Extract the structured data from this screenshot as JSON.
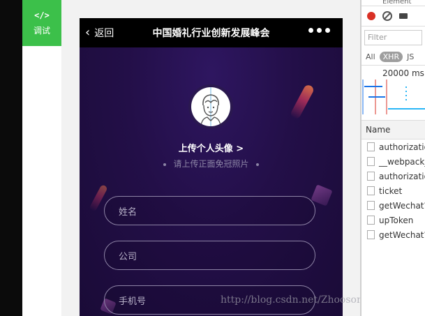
{
  "debug": {
    "icon": "</>",
    "label": "调试"
  },
  "navbar": {
    "back_label": "返回",
    "title": "中国婚礼行业创新发展峰会"
  },
  "profile": {
    "upload_label": "上传个人头像 >",
    "hint": "请上传正面免冠照片"
  },
  "form": {
    "name_placeholder": "姓名",
    "company_placeholder": "公司",
    "phone_placeholder": "手机号"
  },
  "watermark": "http://blog.csdn.net/Zhooson",
  "devtools": {
    "tab_label": "Element",
    "filter_placeholder": "Filter",
    "type_filters": [
      "All",
      "XHR",
      "JS"
    ],
    "timeline_label": "20000 ms",
    "column_header": "Name",
    "requests": [
      "authorization",
      "__webpack_h",
      "authorization",
      "ticket",
      "getWechat?u",
      "upToken",
      "getWechat?u"
    ]
  },
  "colors": {
    "debug_green": "#3cc04a",
    "page_bg": "#23103f",
    "navbar": "#000000"
  }
}
